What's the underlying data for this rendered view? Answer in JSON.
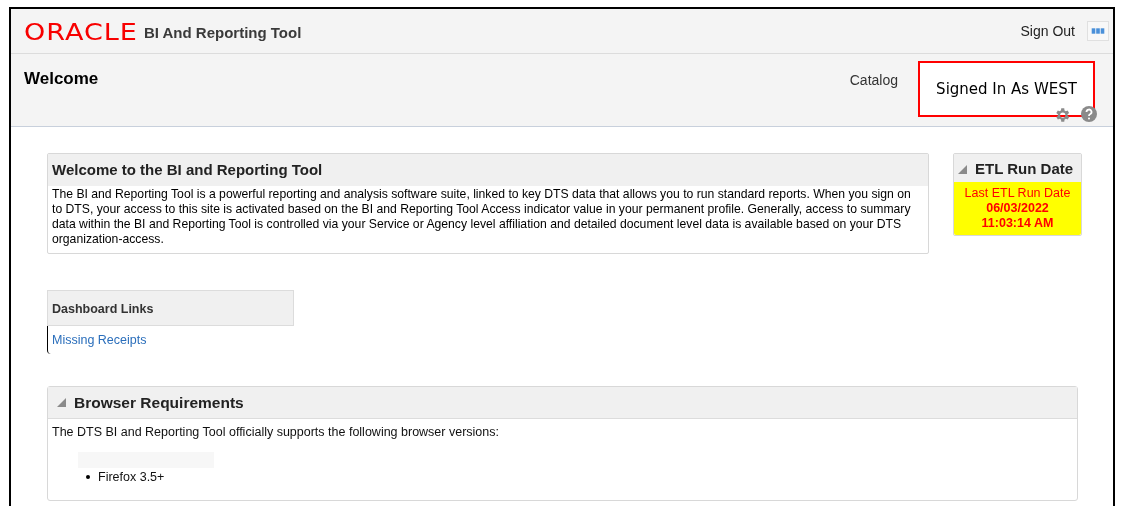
{
  "header": {
    "logo": "ORACLE",
    "app_title": "BI And Reporting Tool",
    "sign_out": "Sign Out"
  },
  "subheader": {
    "title": "Welcome",
    "catalog": "Catalog",
    "signed_in": "Signed In As WEST"
  },
  "welcome_section": {
    "title": "Welcome to the BI and Reporting Tool",
    "body": "The BI and Reporting Tool is a powerful reporting and analysis software suite, linked to key DTS data that allows you to run standard reports. When you sign on to DTS, your access to this site is activated based on the BI and Reporting Tool Access indicator value in your permanent profile. Generally, access to summary data within the BI and Reporting Tool is controlled via your Service or Agency level affiliation and detailed document level data is available based on your DTS organization-access."
  },
  "etl_section": {
    "title": "ETL Run Date",
    "expanded": true,
    "lines": [
      "Last ETL Run Date",
      "06/03/2022",
      "11:03:14 AM"
    ]
  },
  "dashboard_links": {
    "title": "Dashboard Links",
    "links": [
      "Missing Receipts"
    ]
  },
  "browser_requirements": {
    "title": "Browser Requirements",
    "expanded": true,
    "intro": "The DTS BI and Reporting Tool officially supports the following browser versions:",
    "items": [
      "Firefox 3.5+"
    ]
  }
}
